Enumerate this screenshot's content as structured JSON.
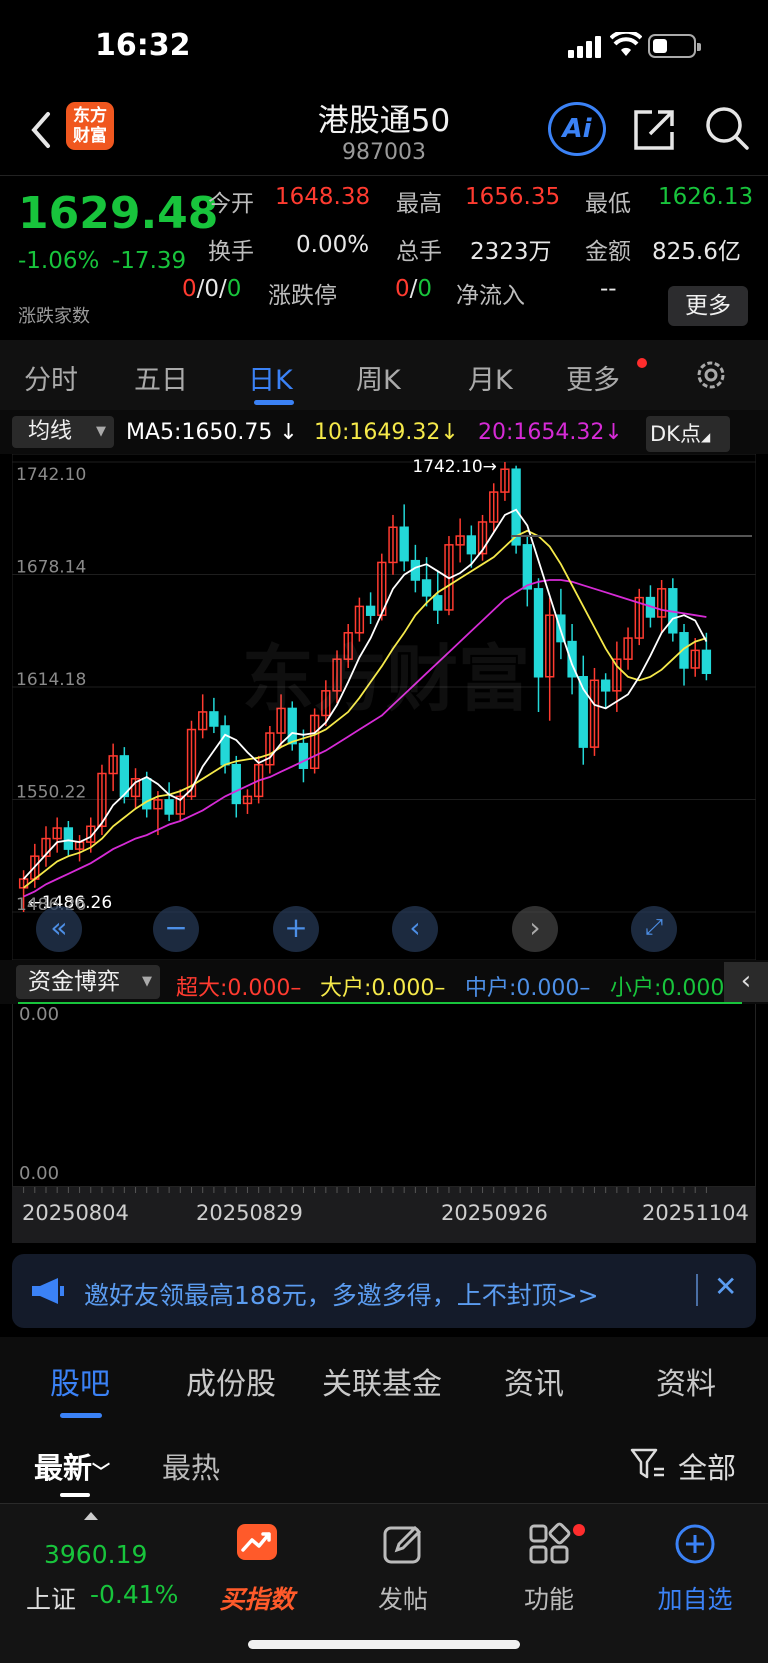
{
  "status": {
    "time": "16:32"
  },
  "nav": {
    "logo_text_line1": "东方",
    "logo_text_line2": "财富",
    "title": "港股通50",
    "code": "987003",
    "ai_label": "Ai"
  },
  "quote": {
    "price": "1629.48",
    "change_pct": "-1.06%",
    "change_abs": "-17.39",
    "open_label": "今开",
    "open": "1648.38",
    "high_label": "最高",
    "high": "1656.35",
    "low_label": "最低",
    "low": "1626.13",
    "turnover_label": "换手",
    "turnover": "0.00%",
    "volume_label": "总手",
    "volume": "2323万",
    "amount_label": "金额",
    "amount": "825.6亿",
    "updown_label": "涨跌家数",
    "updown_a": "0",
    "updown_b": "0",
    "updown_c": "0",
    "limit_label": "涨跌停",
    "limit_a": "0",
    "limit_b": "0",
    "inflow_label": "净流入",
    "inflow": "--",
    "more_label": "更多"
  },
  "ktabs": [
    "分时",
    "五日",
    "日K",
    "周K",
    "月K",
    "更多"
  ],
  "ma": {
    "select": "均线",
    "ma5": "MA5:1650.75",
    "ma10": "10:1649.32",
    "ma20": "20:1654.32",
    "dk": "DK点",
    "color_ma5": "#ffffff",
    "color_ma10": "#f5e94a",
    "color_ma20": "#d62bd6"
  },
  "chart_data": {
    "type": "candlestick",
    "y_ticks": [
      "1742.10",
      "1678.14",
      "1614.18",
      "1550.22",
      "1486.26"
    ],
    "ylim": [
      1486.26,
      1742.1
    ],
    "max_label": "1742.10",
    "min_label": "1486.26",
    "x_ticks": [
      "20250804",
      "20250829",
      "20250926",
      "20251104"
    ],
    "up_color": "#ff3b30",
    "down_color": "#23d8d8",
    "candles": [
      [
        1500,
        1510,
        1486.26,
        1505
      ],
      [
        1505,
        1525,
        1500,
        1518
      ],
      [
        1518,
        1535,
        1512,
        1528
      ],
      [
        1528,
        1540,
        1520,
        1534
      ],
      [
        1534,
        1538,
        1518,
        1522
      ],
      [
        1522,
        1530,
        1515,
        1526
      ],
      [
        1526,
        1540,
        1520,
        1535
      ],
      [
        1535,
        1570,
        1530,
        1565
      ],
      [
        1565,
        1582,
        1555,
        1575
      ],
      [
        1575,
        1580,
        1548,
        1552
      ],
      [
        1552,
        1568,
        1545,
        1562
      ],
      [
        1562,
        1566,
        1540,
        1545
      ],
      [
        1545,
        1555,
        1530,
        1550
      ],
      [
        1550,
        1560,
        1538,
        1542
      ],
      [
        1542,
        1556,
        1538,
        1552
      ],
      [
        1552,
        1595,
        1550,
        1590
      ],
      [
        1590,
        1610,
        1585,
        1600
      ],
      [
        1600,
        1608,
        1588,
        1592
      ],
      [
        1592,
        1598,
        1565,
        1570
      ],
      [
        1570,
        1575,
        1540,
        1548
      ],
      [
        1548,
        1556,
        1542,
        1552
      ],
      [
        1552,
        1575,
        1548,
        1570
      ],
      [
        1570,
        1592,
        1565,
        1588
      ],
      [
        1588,
        1610,
        1580,
        1602
      ],
      [
        1602,
        1606,
        1578,
        1582
      ],
      [
        1582,
        1590,
        1560,
        1568
      ],
      [
        1568,
        1602,
        1565,
        1598
      ],
      [
        1598,
        1618,
        1592,
        1612
      ],
      [
        1612,
        1635,
        1605,
        1630
      ],
      [
        1630,
        1650,
        1625,
        1645
      ],
      [
        1645,
        1665,
        1640,
        1660
      ],
      [
        1660,
        1668,
        1650,
        1655
      ],
      [
        1655,
        1690,
        1652,
        1685
      ],
      [
        1685,
        1712,
        1678,
        1705
      ],
      [
        1705,
        1718,
        1680,
        1686
      ],
      [
        1686,
        1695,
        1668,
        1675
      ],
      [
        1675,
        1688,
        1660,
        1666
      ],
      [
        1666,
        1680,
        1650,
        1658
      ],
      [
        1658,
        1700,
        1655,
        1695
      ],
      [
        1695,
        1710,
        1685,
        1700
      ],
      [
        1700,
        1706,
        1682,
        1690
      ],
      [
        1690,
        1712,
        1686,
        1708
      ],
      [
        1708,
        1730,
        1702,
        1725
      ],
      [
        1725,
        1742.1,
        1720,
        1738
      ],
      [
        1738,
        1740,
        1690,
        1695
      ],
      [
        1695,
        1700,
        1660,
        1670
      ],
      [
        1670,
        1676,
        1600,
        1620
      ],
      [
        1620,
        1665,
        1595,
        1655
      ],
      [
        1655,
        1670,
        1630,
        1640
      ],
      [
        1640,
        1650,
        1610,
        1620
      ],
      [
        1620,
        1632,
        1570,
        1580
      ],
      [
        1580,
        1625,
        1575,
        1618
      ],
      [
        1618,
        1622,
        1602,
        1612
      ],
      [
        1612,
        1640,
        1600,
        1630
      ],
      [
        1630,
        1648,
        1624,
        1642
      ],
      [
        1642,
        1670,
        1638,
        1665
      ],
      [
        1665,
        1672,
        1648,
        1654
      ],
      [
        1654,
        1675,
        1645,
        1670
      ],
      [
        1670,
        1676,
        1640,
        1645
      ],
      [
        1645,
        1650,
        1615,
        1625
      ],
      [
        1625,
        1642,
        1620,
        1635
      ],
      [
        1635,
        1645,
        1618,
        1622
      ]
    ],
    "ma5": [
      1505,
      1512,
      1519,
      1526,
      1527,
      1526,
      1529,
      1537,
      1547,
      1553,
      1560,
      1563,
      1559,
      1553,
      1550,
      1556,
      1569,
      1578,
      1587,
      1584,
      1577,
      1571,
      1574,
      1582,
      1588,
      1587,
      1588,
      1594,
      1604,
      1617,
      1631,
      1642,
      1656,
      1670,
      1678,
      1682,
      1684,
      1680,
      1676,
      1679,
      1684,
      1692,
      1702,
      1712,
      1715,
      1706,
      1686,
      1666,
      1646,
      1627,
      1613,
      1604,
      1602,
      1606,
      1610,
      1620,
      1632,
      1645,
      1653,
      1655,
      1652,
      1640
    ],
    "ma10": [
      1500,
      1505,
      1510,
      1515,
      1518,
      1520,
      1523,
      1528,
      1535,
      1540,
      1545,
      1549,
      1552,
      1553,
      1555,
      1558,
      1562,
      1566,
      1570,
      1572,
      1573,
      1574,
      1576,
      1580,
      1583,
      1585,
      1587,
      1590,
      1595,
      1600,
      1608,
      1617,
      1626,
      1636,
      1645,
      1655,
      1662,
      1668,
      1672,
      1676,
      1680,
      1684,
      1688,
      1694,
      1700,
      1703,
      1700,
      1694,
      1684,
      1672,
      1660,
      1648,
      1636,
      1626,
      1620,
      1618,
      1620,
      1624,
      1630,
      1636,
      1640,
      1642
    ],
    "ma20": [
      1495,
      1498,
      1502,
      1505,
      1508,
      1511,
      1514,
      1518,
      1522,
      1525,
      1528,
      1530,
      1533,
      1536,
      1538,
      1541,
      1544,
      1548,
      1552,
      1555,
      1558,
      1561,
      1563,
      1566,
      1569,
      1572,
      1575,
      1578,
      1582,
      1586,
      1590,
      1594,
      1598,
      1604,
      1610,
      1616,
      1622,
      1628,
      1634,
      1640,
      1646,
      1652,
      1658,
      1664,
      1668,
      1672,
      1674,
      1675,
      1675,
      1674,
      1672,
      1670,
      1668,
      1666,
      1664,
      1662,
      1660,
      1658,
      1657,
      1656,
      1655,
      1654
    ]
  },
  "fund": {
    "select": "资金博弈",
    "super": "超大:0.000",
    "large": "大户:0.000",
    "mid": "中户:0.000",
    "small": "小户:0.000",
    "top": "0.00",
    "bottom": "0.00"
  },
  "banner": {
    "text": "邀好友领最高188元，多邀多得，上不封顶>>"
  },
  "btabs": [
    "股吧",
    "成份股",
    "关联基金",
    "资讯",
    "资料"
  ],
  "sort": {
    "new": "最新",
    "hot": "最热",
    "all": "全部"
  },
  "bottom_nav": {
    "index_value": "3960.19",
    "index_name": "上证",
    "index_pct": "-0.41%",
    "buy": "买指数",
    "post": "发帖",
    "func": "功能",
    "add": "加自选"
  }
}
